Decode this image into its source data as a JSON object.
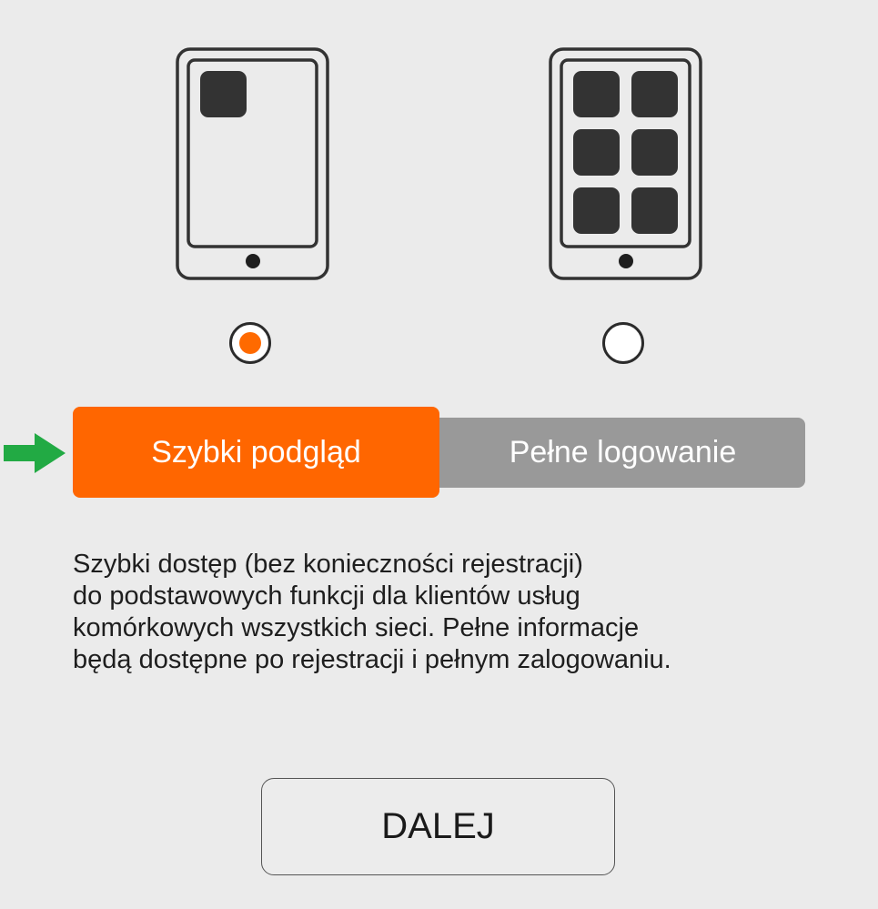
{
  "modes": {
    "quick": {
      "label": "Szybki podgląd",
      "selected": true,
      "icon": "tablet-single-app-icon"
    },
    "full": {
      "label": "Pełne logowanie",
      "selected": false,
      "icon": "tablet-multi-app-icon"
    }
  },
  "pointer_icon": "green-arrow-right-icon",
  "description": {
    "lines": [
      "Szybki dostęp (bez konieczności rejestracji)",
      "do podstawowych funkcji dla klientów usług",
      "komórkowych wszystkich sieci. Pełne informacje",
      "będą dostępne po rejestracji i pełnym zalogowaniu."
    ]
  },
  "next_button": {
    "label": "DALEJ"
  },
  "colors": {
    "accent": "#ff6600",
    "inactive_tab": "#999999",
    "background": "#ebebeb",
    "pointer": "#22aa44",
    "icon_dark": "#333333"
  }
}
